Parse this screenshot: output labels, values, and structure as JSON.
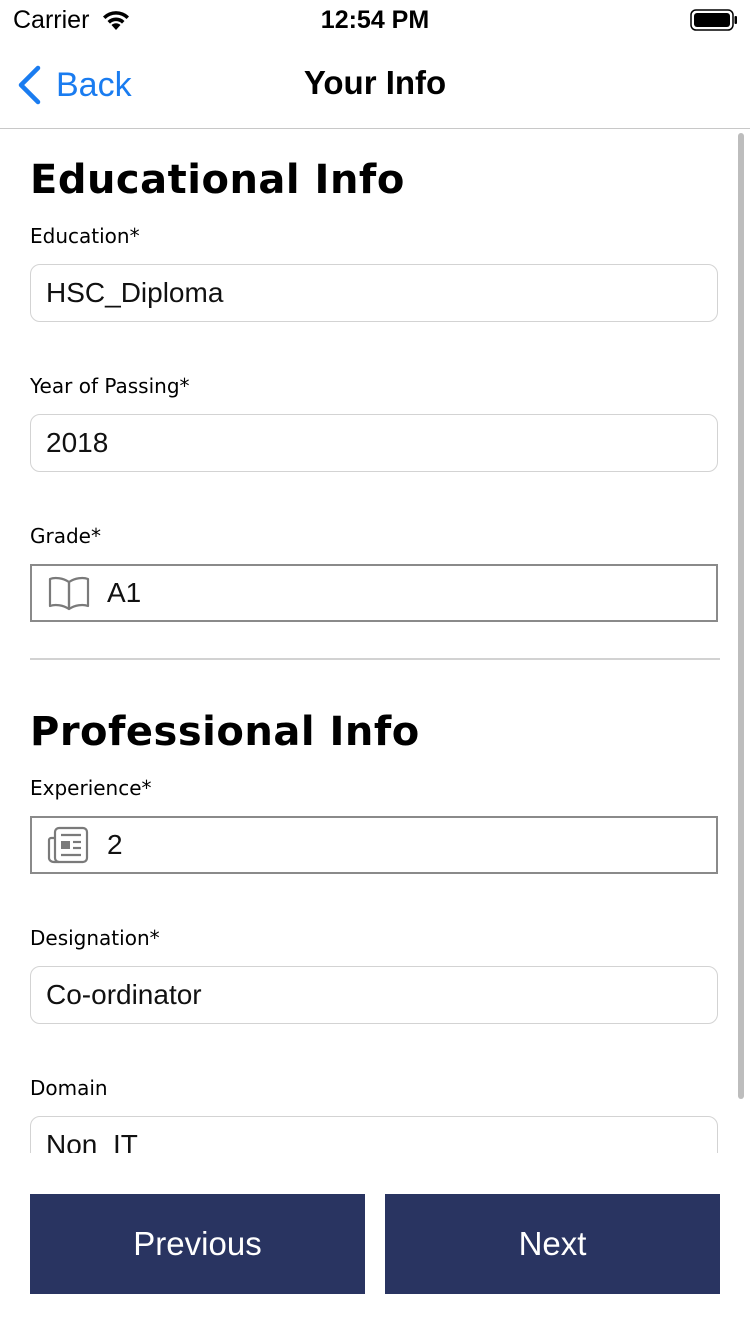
{
  "status_bar": {
    "carrier": "Carrier",
    "time": "12:54 PM"
  },
  "nav": {
    "back_label": "Back",
    "title": "Your Info"
  },
  "educational": {
    "title": "Educational Info",
    "education_label": "Education*",
    "education_value": "HSC_Diploma",
    "year_label": "Year of Passing*",
    "year_value": "2018",
    "grade_label": "Grade*",
    "grade_value": "A1",
    "grade_icon": "book-icon"
  },
  "professional": {
    "title": "Professional Info",
    "experience_label": "Experience*",
    "experience_value": "2",
    "experience_icon": "newspaper-icon",
    "designation_label": "Designation*",
    "designation_value": "Co-ordinator",
    "domain_label": "Domain",
    "domain_value": "Non_IT"
  },
  "buttons": {
    "previous": "Previous",
    "next": "Next"
  },
  "colors": {
    "accent": "#1a7cf0",
    "button_bg": "#293461",
    "button_text": "#ffffff"
  }
}
